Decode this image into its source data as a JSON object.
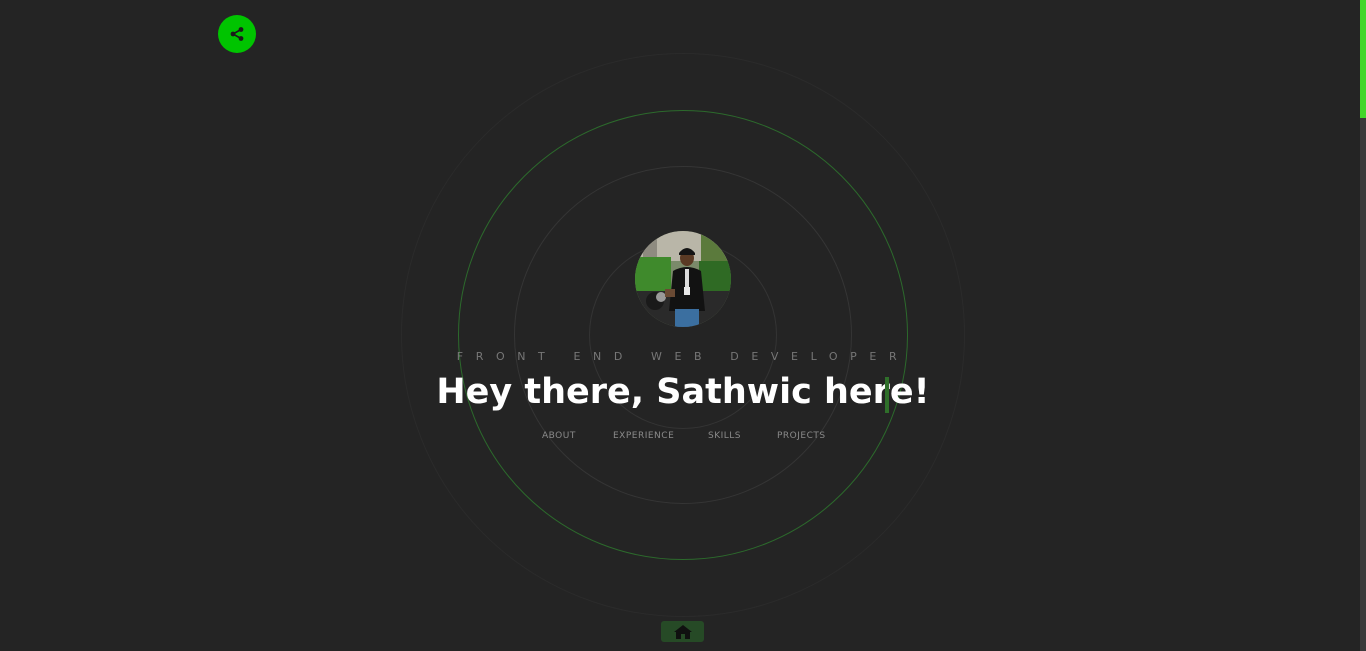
{
  "header": {
    "share_icon": "share-icon",
    "share_color": "#00c400"
  },
  "profile": {
    "avatar_icon": "profile-photo"
  },
  "hero": {
    "subtitle": "FRONT END WEB DEVELOPER",
    "headline": "Hey there, Sathwic here!",
    "cursor_color": "#2f6f2a"
  },
  "nav": {
    "items": [
      {
        "label": "ABOUT"
      },
      {
        "label": "EXPERIENCE"
      },
      {
        "label": "SKILLS"
      },
      {
        "label": "PROJECTS"
      }
    ]
  },
  "footer": {
    "home_icon": "home-icon"
  },
  "scroll": {
    "position_fraction": 0.0,
    "thumb_color": "#43d62a"
  },
  "theme": {
    "background": "#242424",
    "accent": "#00c400"
  }
}
